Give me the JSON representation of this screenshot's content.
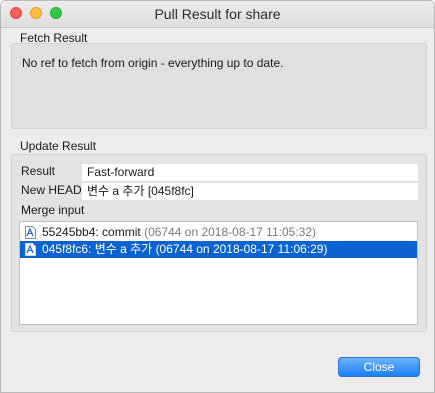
{
  "window": {
    "title": "Pull Result for share"
  },
  "fetch": {
    "heading": "Fetch Result",
    "message": "No ref to fetch from origin - everything up to date."
  },
  "update": {
    "heading": "Update Result",
    "result_label": "Result",
    "result_value": "Fast-forward",
    "new_head_label": "New HEAD",
    "new_head_value": "변수 a 추가 [045f8fc]",
    "merge_input_label": "Merge input",
    "merge_items": [
      {
        "commit": "55245bb4: commit",
        "detail": "(06744 on 2018-08-17 11:05:32)",
        "selected": false,
        "icon": "commit-file-icon"
      },
      {
        "commit": "045f8fc6: 변수 a 추가",
        "detail": "(06744 on 2018-08-17 11:06:29)",
        "selected": true,
        "icon": "commit-file-icon"
      }
    ]
  },
  "buttons": {
    "close_label": "Close"
  },
  "colors": {
    "accent": "#0b63d1",
    "close_red": "#fc605b",
    "minimize_yellow": "#fdbc40",
    "maximize_green": "#34c84a"
  }
}
